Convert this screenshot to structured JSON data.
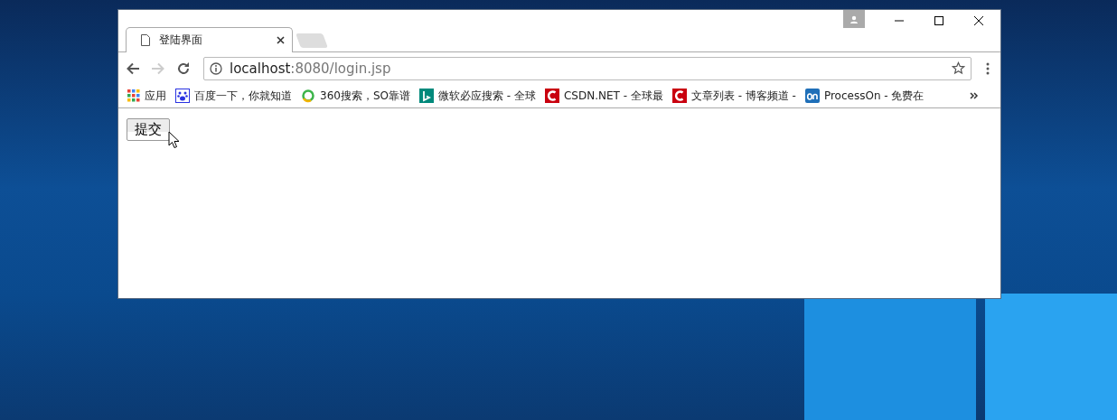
{
  "window": {
    "tabs": [
      {
        "title": "登陆界面",
        "selected": true
      },
      {
        "selected": false
      }
    ]
  },
  "nav": [
    {
      "kind": "back",
      "disabled": false
    },
    {
      "kind": "forward",
      "disabled": true
    },
    {
      "kind": "reload",
      "disabled": false
    }
  ],
  "address_bar": {
    "host": "localhost",
    "path": ":8080/login.jsp"
  },
  "bookmarks": [
    {
      "kind": "apps",
      "label": "应用"
    },
    {
      "kind": "paw",
      "label": "百度一下，你就知道"
    },
    {
      "kind": "ring",
      "label": "360搜索，SO靠谱"
    },
    {
      "kind": "b",
      "label": "微软必应搜索 - 全球"
    },
    {
      "kind": "c",
      "label": "CSDN.NET - 全球最"
    },
    {
      "kind": "c",
      "label": "文章列表 - 博客频道 -"
    },
    {
      "kind": "on",
      "label": "ProcessOn - 免费在"
    }
  ],
  "page": {
    "submit_button": "提交"
  }
}
